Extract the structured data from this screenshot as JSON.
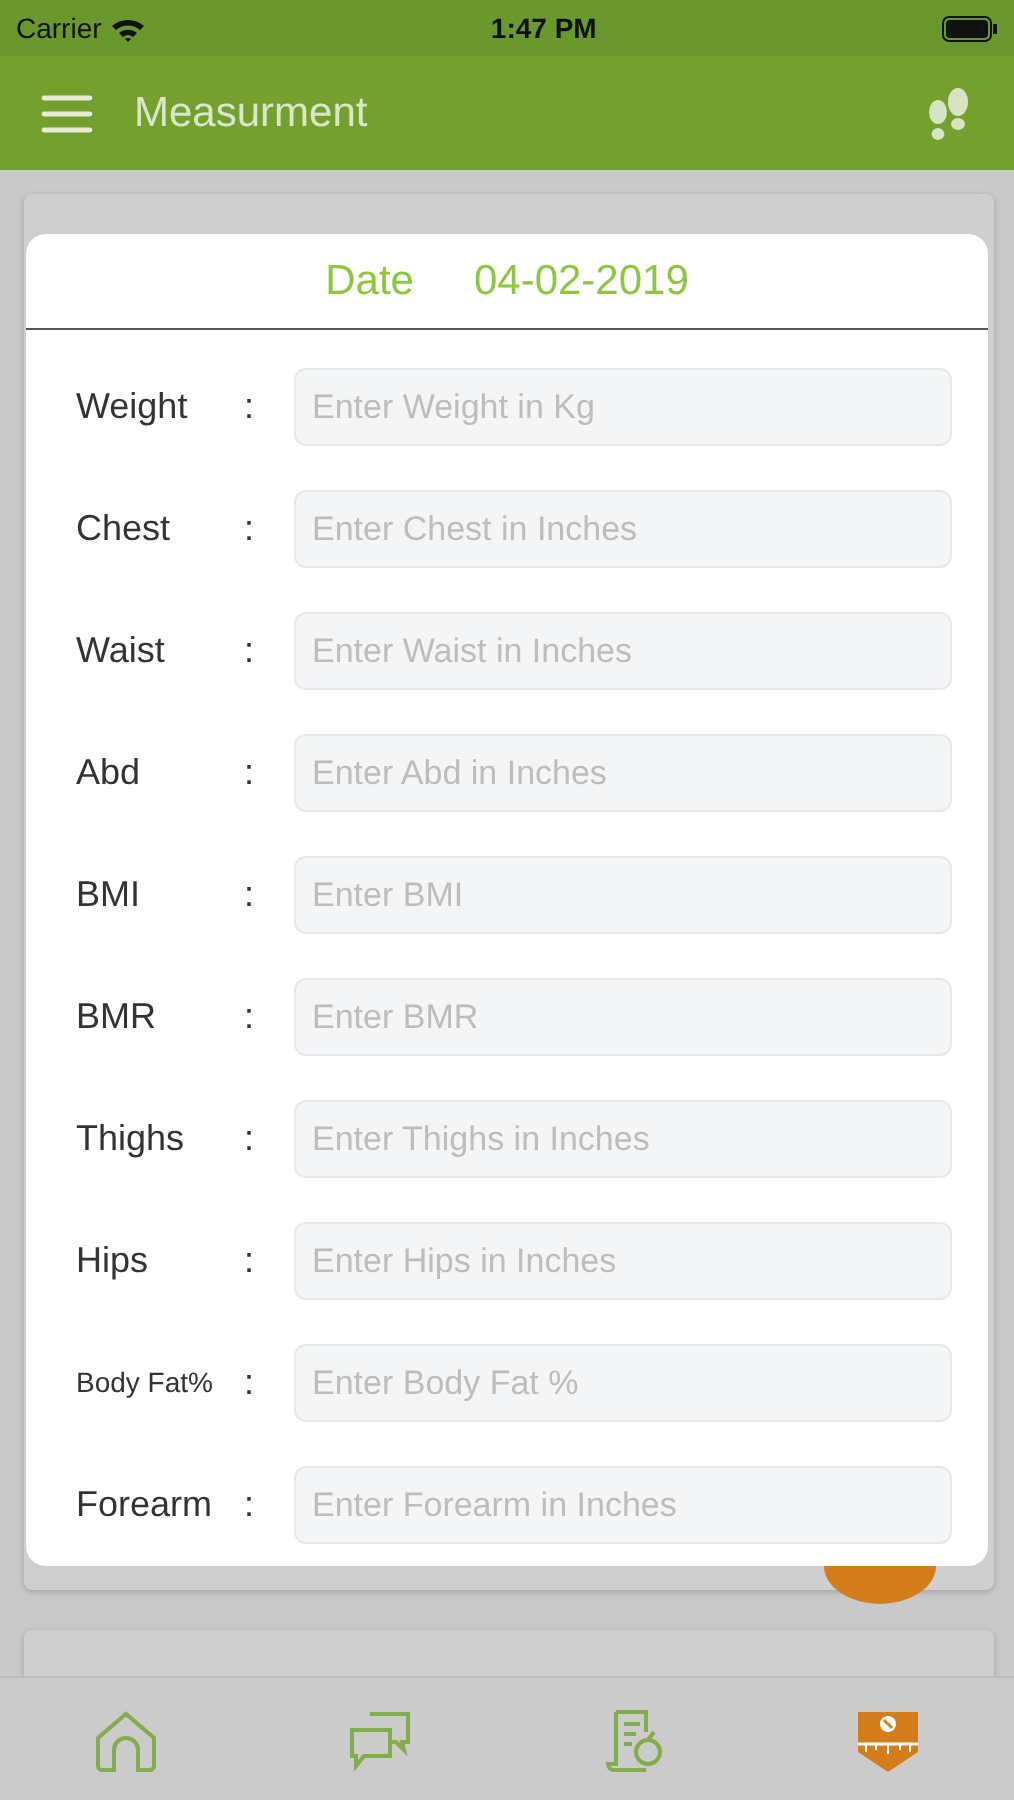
{
  "status_bar": {
    "carrier": "Carrier",
    "time": "1:47 PM"
  },
  "header": {
    "title": "Measurment"
  },
  "dialog": {
    "date_label": "Date",
    "date_value": "04-02-2019",
    "fields": [
      {
        "label": "Weight",
        "separator": ":",
        "placeholder": "Enter Weight in Kg",
        "kind": "normal"
      },
      {
        "label": "Chest",
        "separator": ":",
        "placeholder": "Enter Chest in Inches",
        "kind": "normal"
      },
      {
        "label": "Waist",
        "separator": ":",
        "placeholder": "Enter Waist in Inches",
        "kind": "normal"
      },
      {
        "label": "Abd",
        "separator": ":",
        "placeholder": "Enter Abd in Inches",
        "kind": "normal"
      },
      {
        "label": "BMI",
        "separator": ":",
        "placeholder": "Enter BMI",
        "kind": "normal"
      },
      {
        "label": "BMR",
        "separator": ":",
        "placeholder": "Enter BMR",
        "kind": "normal"
      },
      {
        "label": "Thighs",
        "separator": ":",
        "placeholder": "Enter Thighs in Inches",
        "kind": "normal"
      },
      {
        "label": "Hips",
        "separator": ":",
        "placeholder": "Enter Hips in Inches",
        "kind": "normal"
      },
      {
        "label": "Body Fat%",
        "separator": ":",
        "placeholder": "Enter Body Fat %",
        "kind": "compact"
      },
      {
        "label": "Forearm",
        "separator": ":",
        "placeholder": "Enter Forearm in Inches",
        "kind": "normal"
      }
    ]
  },
  "tabs": [
    {
      "kind": "home",
      "selected": false
    },
    {
      "kind": "chat",
      "selected": false
    },
    {
      "kind": "diet",
      "selected": false
    },
    {
      "kind": "tape",
      "selected": true
    }
  ]
}
